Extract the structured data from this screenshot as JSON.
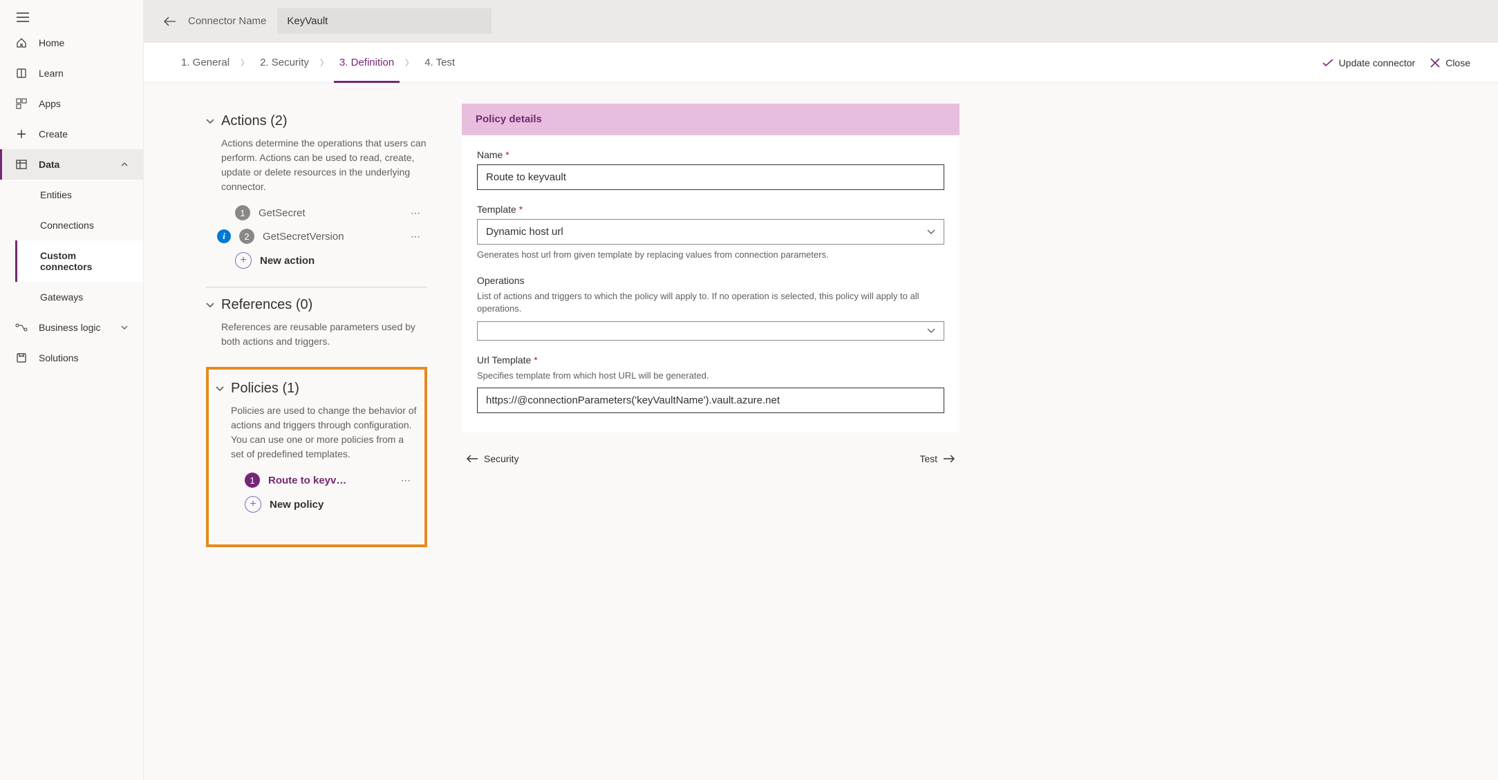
{
  "sidebar": {
    "items": [
      {
        "label": "Home"
      },
      {
        "label": "Learn"
      },
      {
        "label": "Apps"
      },
      {
        "label": "Create"
      },
      {
        "label": "Data"
      },
      {
        "label": "Business logic"
      },
      {
        "label": "Solutions"
      }
    ],
    "data_children": [
      {
        "label": "Entities"
      },
      {
        "label": "Connections"
      },
      {
        "label": "Custom connectors"
      },
      {
        "label": "Gateways"
      }
    ]
  },
  "topbar": {
    "label": "Connector Name",
    "connector_value": "KeyVault"
  },
  "steps": {
    "s1": "1. General",
    "s2": "2. Security",
    "s3": "3. Definition",
    "s4": "4. Test"
  },
  "actions": {
    "update": "Update connector",
    "close": "Close"
  },
  "sections": {
    "actions": {
      "title": "Actions (2)",
      "desc": "Actions determine the operations that users can perform. Actions can be used to read, create, update or delete resources in the underlying connector.",
      "items": [
        "GetSecret",
        "GetSecretVersion"
      ],
      "new": "New action"
    },
    "references": {
      "title": "References (0)",
      "desc": "References are reusable parameters used by both actions and triggers."
    },
    "policies": {
      "title": "Policies (1)",
      "desc": "Policies are used to change the behavior of actions and triggers through configuration. You can use one or more policies from a set of predefined templates.",
      "items": [
        "Route to keyv…"
      ],
      "new": "New policy"
    }
  },
  "detail": {
    "header": "Policy details",
    "fields": {
      "name": {
        "label": "Name",
        "value": "Route to keyvault"
      },
      "template": {
        "label": "Template",
        "value": "Dynamic host url",
        "help": "Generates host url from given template by replacing values from connection parameters."
      },
      "operations": {
        "label": "Operations",
        "help": "List of actions and triggers to which the policy will apply to. If no operation is selected, this policy will apply to all operations."
      },
      "url_template": {
        "label": "Url Template",
        "help": "Specifies template from which host URL will be generated.",
        "value": "https://@connectionParameters('keyVaultName').vault.azure.net"
      }
    }
  },
  "footer_nav": {
    "prev": "Security",
    "next": "Test"
  }
}
